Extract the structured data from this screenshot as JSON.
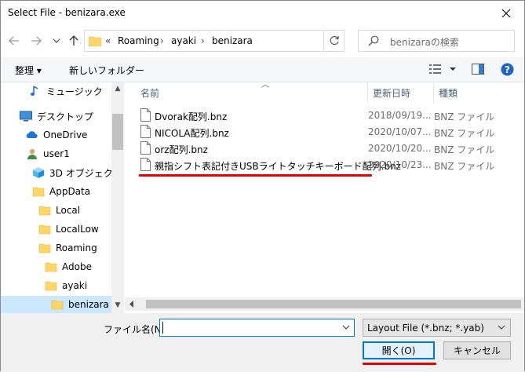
{
  "window": {
    "title": "Select File - benizara.exe"
  },
  "address": {
    "overflow": "«",
    "crumbs": [
      "Roaming",
      "ayaki",
      "benizara"
    ],
    "separator": "›"
  },
  "search": {
    "placeholder": "benizaraの検索"
  },
  "toolbar": {
    "organize": "整理 ▾",
    "new_folder": "新しいフォルダー"
  },
  "tree": [
    {
      "label": "ミュージック",
      "icon": "music-note-icon"
    },
    {
      "label": "デスクトップ",
      "icon": "desktop-icon"
    },
    {
      "label": "OneDrive",
      "icon": "cloud-icon"
    },
    {
      "label": "user1",
      "icon": "user-icon"
    },
    {
      "label": "3D オブジェクト",
      "icon": "cube-icon"
    },
    {
      "label": "AppData",
      "icon": "folder-icon"
    },
    {
      "label": "Local",
      "icon": "folder-icon"
    },
    {
      "label": "LocalLow",
      "icon": "folder-icon"
    },
    {
      "label": "Roaming",
      "icon": "folder-icon"
    },
    {
      "label": "Adobe",
      "icon": "folder-icon"
    },
    {
      "label": "ayaki",
      "icon": "folder-icon"
    },
    {
      "label": "benizara",
      "icon": "folder-icon"
    }
  ],
  "columns": {
    "name": "名前",
    "date": "更新日時",
    "type": "種類"
  },
  "files": [
    {
      "name": "Dvorak配列.bnz",
      "date": "2018/09/19...",
      "type": "BNZ ファイル"
    },
    {
      "name": "NICOLA配列.bnz",
      "date": "2020/10/07...",
      "type": "BNZ ファイル"
    },
    {
      "name": "orz配列.bnz",
      "date": "2020/10/20...",
      "type": "BNZ ファイル"
    },
    {
      "name": "親指シフト表記付きUSBライトタッチキーボード配列.bnz",
      "date": "2020/10/23...",
      "type": "BNZ ファイル"
    }
  ],
  "bottom": {
    "filename_label": "ファイル名(N):",
    "filename_value": "",
    "filetype": "Layout File (*.bnz; *.yab)",
    "open": "開く(O)",
    "cancel": "キャンセル"
  },
  "colors": {
    "accent": "#0078d7",
    "highlight": "#e60000",
    "selected": "#cce8ff"
  }
}
